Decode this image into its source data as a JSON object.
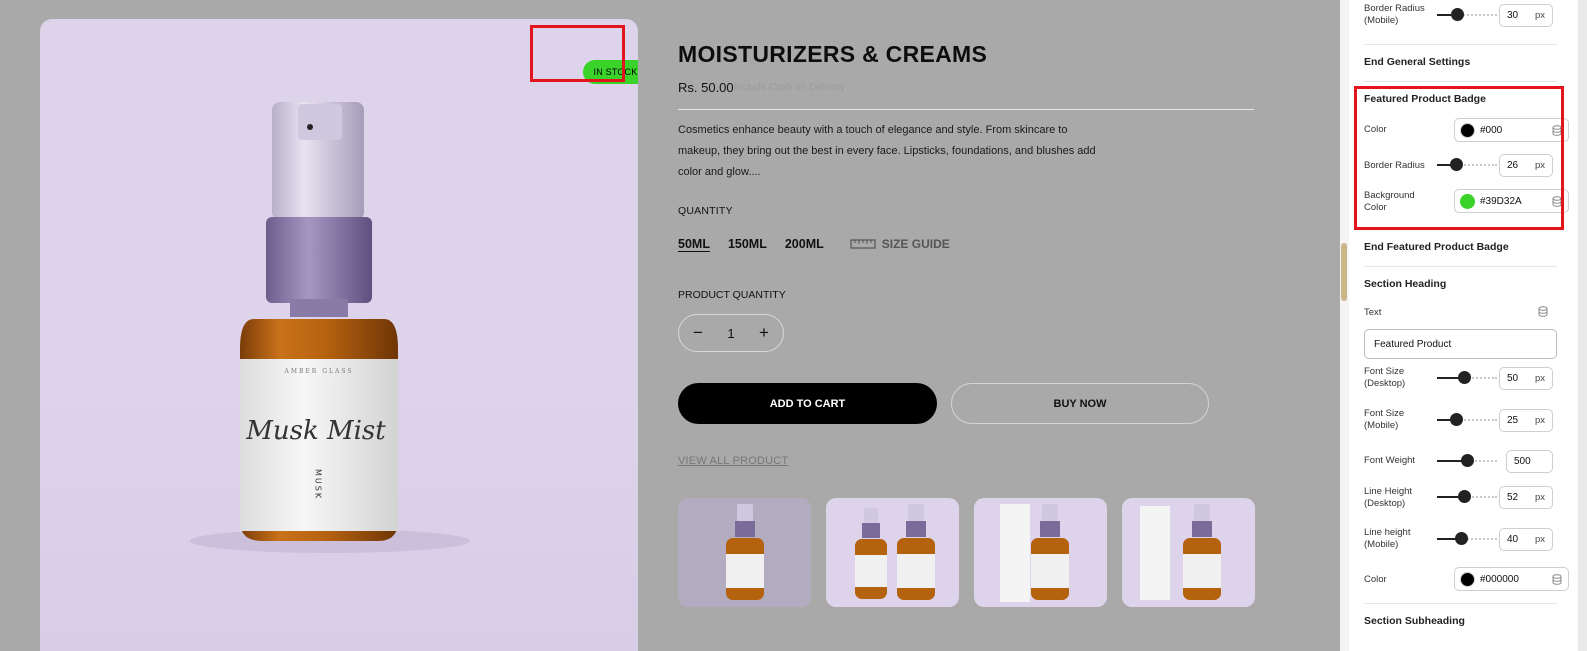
{
  "product": {
    "badge": "IN STOCK",
    "badge_color": "#39D32A",
    "title": "MOISTURIZERS & CREAMS",
    "price": "Rs. 50.00",
    "price_note": "Include Cash on Delivery",
    "description": "Cosmetics enhance beauty with a touch of elegance and style. From skincare to makeup, they bring out the best in every face. Lipsticks, foundations, and blushes add color and glow....",
    "quantity_label": "QUANTITY",
    "sizes": [
      "50ML",
      "150ML",
      "200ML"
    ],
    "size_guide": "SIZE GUIDE",
    "product_quantity_label": "PRODUCT QUANTITY",
    "qty_minus": "−",
    "qty_value": "1",
    "qty_plus": "+",
    "add_to_cart": "ADD TO CART",
    "buy_now": "BUY NOW",
    "view_all": "VIEW ALL PRODUCT",
    "bottle_label_top": "AMBER GLASS",
    "bottle_label_script": "Musk Mist",
    "bottle_label_vertical": "MUSK"
  },
  "panel": {
    "border_radius_mobile_label": "Border Radius (Mobile)",
    "border_radius_mobile_value": "30",
    "unit_px": "px",
    "end_general": "End General Settings",
    "featured_badge_heading": "Featured Product Badge",
    "color_label": "Color",
    "color_value": "#000",
    "color_swatch": "#000000",
    "border_radius_label": "Border Radius",
    "border_radius_value": "26",
    "bg_color_label": "Background Color",
    "bg_color_value": "#39D32A",
    "end_featured_badge": "End Featured Product Badge",
    "section_heading": "Section Heading",
    "text_label": "Text",
    "text_value": "Featured Product",
    "font_size_desktop_label": "Font Size (Desktop)",
    "font_size_desktop_value": "50",
    "font_size_mobile_label": "Font Size (Mobile)",
    "font_size_mobile_value": "25",
    "font_weight_label": "Font Weight",
    "font_weight_value": "500",
    "line_height_desktop_label": "Line Height (Desktop)",
    "line_height_desktop_value": "52",
    "line_height_mobile_label": "Line height (Mobile)",
    "line_height_mobile_value": "40",
    "heading_color_label": "Color",
    "heading_color_value": "#000000",
    "section_subheading": "Section Subheading",
    "slider_levels": {
      "border_radius_mobile": 0.3,
      "border_radius": 0.27,
      "font_size_desktop": 0.45,
      "font_size_mobile": 0.28,
      "font_weight": 0.5,
      "line_height_desktop": 0.45,
      "line_height_mobile": 0.38
    }
  }
}
